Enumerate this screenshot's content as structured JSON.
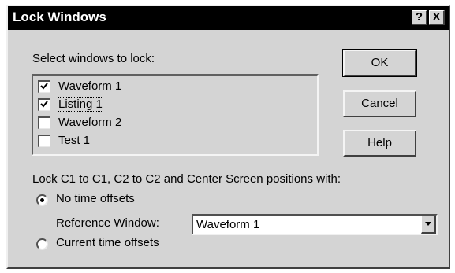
{
  "dialog": {
    "title": "Lock Windows",
    "help_button": "?",
    "close_button": "X"
  },
  "select_label": "Select windows to lock:",
  "windows": [
    {
      "label": "Waveform 1",
      "checked": true
    },
    {
      "label": "Listing 1",
      "checked": true
    },
    {
      "label": "Waveform 2",
      "checked": false
    },
    {
      "label": "Test 1",
      "checked": false
    }
  ],
  "buttons": {
    "ok": "OK",
    "cancel": "Cancel",
    "help": "Help"
  },
  "lock_label": "Lock C1 to C1, C2 to C2 and Center Screen positions with:",
  "options": {
    "no_offsets": "No time offsets",
    "current_offsets": "Current time offsets",
    "selected": "no_offsets"
  },
  "reference": {
    "label": "Reference Window:",
    "value": "Waveform 1"
  }
}
